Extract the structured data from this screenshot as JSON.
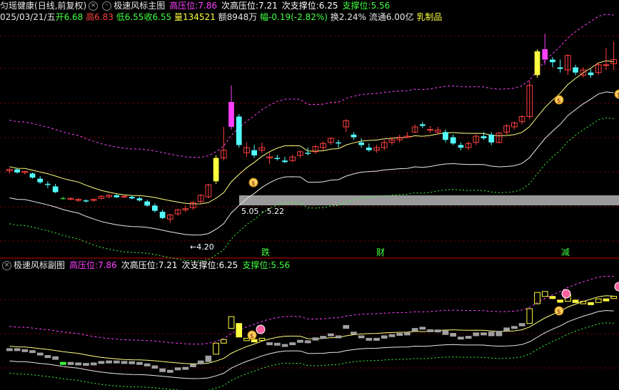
{
  "header": {
    "stock_name": "匀瑶健康",
    "period": "(日线,前复权)",
    "indicator": "极速风标主图",
    "high_press_label": "高压位:",
    "high_press": "7.86",
    "sub_high_label": "次高压位:",
    "sub_high": "7.21",
    "sub_support_label": "次支撑位:",
    "sub_support": "6.25",
    "support_label": "支撑位:",
    "support": "5.56"
  },
  "quote": {
    "date": "025/03/21/五",
    "open_label": "开",
    "open": "6.68",
    "high_label": "高",
    "high": "6.83",
    "low_label": "低",
    "low": "6.55",
    "close_label": "收",
    "close": "6.55",
    "vol_label": "量",
    "vol": "134521",
    "amount_label": "额",
    "amount": "8948万",
    "chg_label": "幅",
    "chg": "-0.19(-2.82%)",
    "turnover_label": "换",
    "turnover": "2.24%",
    "float_label": "流通",
    "float_cap": "6.00亿",
    "sector": "乳制品"
  },
  "annotations": {
    "low_price": "4.20",
    "band": "5.05 - 5.22",
    "money_glyph": "$",
    "markers": [
      "跌",
      "财",
      "减"
    ]
  },
  "sub_header": {
    "indicator": "极速风标副图",
    "high_press_label": "高压位:",
    "high_press": "7.86",
    "sub_high_label": "次高压位:",
    "sub_high": "7.21",
    "sub_support_label": "次支撑位:",
    "sub_support": "6.25",
    "support_label": "支撑位:",
    "support": "5.56"
  },
  "colors": {
    "up": "#ff4040",
    "down": "#54ffff",
    "yellow": "#ffff40",
    "magenta": "#ff40ff",
    "green": "#40ff40",
    "white": "#e8e8e8",
    "grid": "#8a0000",
    "gray": "#a0a0a0"
  },
  "chart_data": {
    "type": "candlestick",
    "note_scale": "price",
    "ylim": [
      4.1,
      8.3
    ],
    "candles": [
      [
        5.55,
        5.6,
        5.5,
        5.58
      ],
      [
        5.58,
        5.6,
        5.5,
        5.52
      ],
      [
        5.52,
        5.55,
        5.48,
        5.54
      ],
      [
        5.5,
        5.52,
        5.4,
        5.42
      ],
      [
        5.4,
        5.45,
        5.3,
        5.33
      ],
      [
        5.3,
        5.35,
        5.22,
        5.28
      ],
      [
        5.25,
        5.3,
        5.12,
        5.14
      ],
      [
        5.02,
        5.05,
        5.0,
        5.02
      ],
      [
        5.0,
        5.04,
        4.98,
        5.02
      ],
      [
        4.98,
        5.02,
        4.95,
        5.0
      ],
      [
        4.98,
        5.0,
        4.94,
        4.96
      ],
      [
        4.98,
        5.02,
        4.95,
        5.0
      ],
      [
        5.02,
        5.08,
        5.0,
        5.06
      ],
      [
        5.05,
        5.1,
        5.02,
        5.08
      ],
      [
        5.08,
        5.1,
        5.03,
        5.04
      ],
      [
        5.05,
        5.08,
        5.02,
        5.06
      ],
      [
        5.05,
        5.08,
        5.0,
        5.02
      ],
      [
        5.02,
        5.05,
        4.96,
        4.98
      ],
      [
        4.96,
        4.99,
        4.86,
        4.88
      ],
      [
        4.88,
        4.92,
        4.75,
        4.78
      ],
      [
        4.76,
        4.8,
        4.62,
        4.64
      ],
      [
        4.62,
        4.72,
        4.55,
        4.7
      ],
      [
        4.72,
        4.82,
        4.68,
        4.8
      ],
      [
        4.8,
        4.88,
        4.75,
        4.82
      ],
      [
        4.84,
        4.96,
        4.8,
        4.94
      ],
      [
        4.96,
        5.1,
        4.92,
        5.08
      ],
      [
        5.05,
        5.3,
        5.02,
        5.28
      ],
      [
        5.35,
        5.85,
        5.3,
        5.8
      ],
      [
        5.8,
        6.4,
        5.75,
        5.95
      ],
      [
        6.4,
        7.2,
        6.35,
        6.88
      ],
      [
        6.6,
        6.65,
        6.0,
        6.05
      ],
      [
        5.9,
        6.1,
        5.82,
        6.0
      ],
      [
        5.95,
        6.05,
        5.8,
        5.85
      ],
      [
        5.95,
        6.1,
        5.9,
        6.0
      ],
      [
        5.8,
        5.9,
        5.68,
        5.82
      ],
      [
        5.8,
        5.86,
        5.75,
        5.78
      ],
      [
        5.75,
        5.82,
        5.7,
        5.72
      ],
      [
        5.75,
        5.86,
        5.72,
        5.82
      ],
      [
        5.85,
        5.95,
        5.8,
        5.92
      ],
      [
        5.9,
        6.0,
        5.85,
        5.88
      ],
      [
        5.92,
        6.05,
        5.88,
        6.02
      ],
      [
        6.0,
        6.12,
        5.95,
        6.08
      ],
      [
        6.1,
        6.2,
        6.05,
        6.18
      ],
      [
        6.1,
        6.15,
        6.0,
        6.08
      ],
      [
        6.4,
        6.55,
        6.3,
        6.52
      ],
      [
        6.25,
        6.3,
        6.15,
        6.2
      ],
      [
        6.1,
        6.18,
        6.0,
        6.05
      ],
      [
        6.0,
        6.08,
        5.92,
        5.95
      ],
      [
        5.95,
        6.05,
        5.9,
        6.0
      ],
      [
        6.0,
        6.15,
        5.95,
        6.1
      ],
      [
        6.1,
        6.2,
        6.05,
        6.15
      ],
      [
        6.15,
        6.25,
        6.1,
        6.2
      ],
      [
        6.2,
        6.3,
        6.18,
        6.22
      ],
      [
        6.3,
        6.45,
        6.28,
        6.4
      ],
      [
        6.45,
        6.5,
        6.38,
        6.42
      ],
      [
        6.35,
        6.42,
        6.28,
        6.35
      ],
      [
        6.3,
        6.4,
        6.25,
        6.34
      ],
      [
        6.3,
        6.35,
        6.1,
        6.15
      ],
      [
        6.2,
        6.25,
        6.05,
        6.08
      ],
      [
        6.05,
        6.1,
        5.95,
        6.0
      ],
      [
        6.0,
        6.12,
        5.95,
        6.08
      ],
      [
        6.1,
        6.25,
        6.05,
        6.22
      ],
      [
        6.22,
        6.3,
        6.15,
        6.18
      ],
      [
        6.25,
        6.3,
        6.05,
        6.1
      ],
      [
        6.1,
        6.3,
        6.08,
        6.28
      ],
      [
        6.3,
        6.45,
        6.25,
        6.42
      ],
      [
        6.4,
        6.5,
        6.35,
        6.48
      ],
      [
        6.5,
        6.62,
        6.45,
        6.6
      ],
      [
        6.6,
        7.3,
        6.55,
        7.2
      ],
      [
        7.4,
        7.9,
        7.35,
        7.86
      ],
      [
        7.7,
        8.2,
        7.6,
        7.9
      ],
      [
        7.7,
        7.75,
        7.55,
        7.65
      ],
      [
        7.55,
        7.7,
        7.45,
        7.52
      ],
      [
        7.5,
        7.8,
        7.4,
        7.78
      ],
      [
        7.55,
        7.6,
        7.4,
        7.45
      ],
      [
        7.4,
        7.55,
        7.35,
        7.5
      ],
      [
        7.45,
        7.52,
        7.35,
        7.4
      ],
      [
        7.45,
        7.65,
        7.4,
        7.6
      ],
      [
        7.6,
        7.92,
        7.5,
        7.6
      ],
      [
        7.62,
        8.05,
        7.5,
        7.7
      ]
    ]
  }
}
